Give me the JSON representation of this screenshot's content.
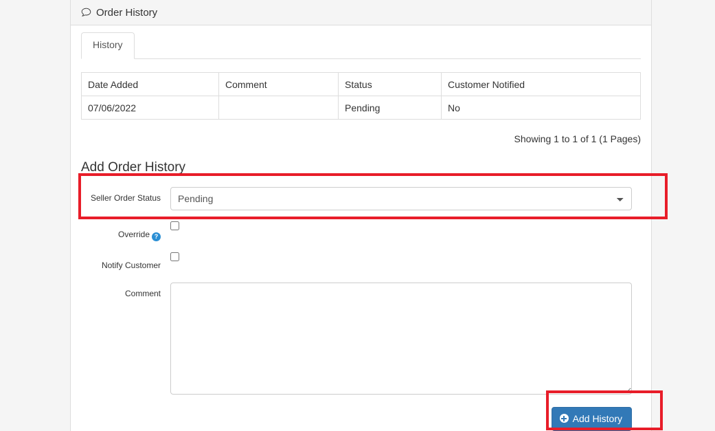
{
  "panel": {
    "heading_title": "Order History",
    "heading_icon": "comment-icon"
  },
  "tabs": [
    {
      "label": "History",
      "active": true
    }
  ],
  "history_table": {
    "columns": [
      "Date Added",
      "Comment",
      "Status",
      "Customer Notified"
    ],
    "rows": [
      {
        "date_added": "07/06/2022",
        "comment": "",
        "status": "Pending",
        "customer_notified": "No"
      }
    ],
    "pagination_text": "Showing 1 to 1 of 1 (1 Pages)"
  },
  "add_form": {
    "section_title": "Add Order History",
    "seller_order_status": {
      "label": "Seller Order Status",
      "value": "Pending",
      "options": [
        "Pending"
      ]
    },
    "override": {
      "label": "Override",
      "help_icon": "question-mark-icon",
      "help_glyph": "?",
      "checked": false
    },
    "notify_customer": {
      "label": "Notify Customer",
      "checked": false
    },
    "comment": {
      "label": "Comment",
      "value": "",
      "placeholder": ""
    },
    "submit_button": {
      "label": "Add History",
      "icon": "plus-circle-icon"
    }
  },
  "annotations": {
    "highlight_color": "#e81d29",
    "boxes": [
      {
        "name": "seller-order-status-row"
      },
      {
        "name": "add-history-button"
      }
    ]
  },
  "colors": {
    "primary_button": "#3279b7",
    "help_icon": "#2b8fd4",
    "panel_border": "#dddddd",
    "page_background": "#f5f5f5"
  }
}
